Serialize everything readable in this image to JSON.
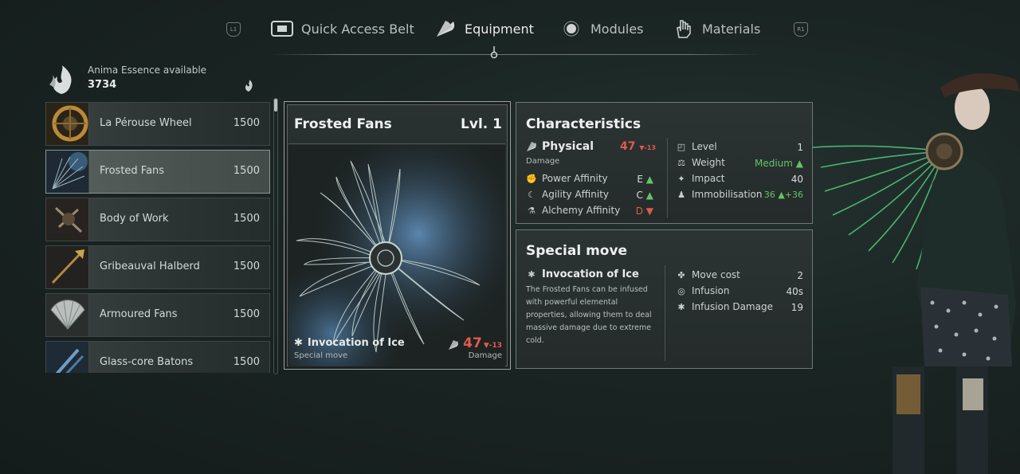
{
  "nav": {
    "left_bumper": "L1",
    "right_bumper": "R1",
    "tabs": [
      {
        "label": "Quick Access Belt",
        "icon": "belt-icon"
      },
      {
        "label": "Equipment",
        "icon": "fan-icon",
        "active": true
      },
      {
        "label": "Modules",
        "icon": "module-icon"
      },
      {
        "label": "Materials",
        "icon": "materials-hand-icon"
      }
    ]
  },
  "anima": {
    "label": "Anima Essence available",
    "value": "3734"
  },
  "weapons": [
    {
      "name": "La Pérouse Wheel",
      "cost": "1500"
    },
    {
      "name": "Frosted Fans",
      "cost": "1500",
      "selected": true
    },
    {
      "name": "Body of Work",
      "cost": "1500"
    },
    {
      "name": "Gribeauval Halberd",
      "cost": "1500"
    },
    {
      "name": "Armoured Fans",
      "cost": "1500"
    },
    {
      "name": "Glass-core Batons",
      "cost": "1500"
    }
  ],
  "card": {
    "title": "Frosted Fans",
    "level": "Lvl. 1",
    "special_move_name": "Invocation of Ice",
    "special_move_label": "Special move",
    "damage_value": "47",
    "damage_delta": "▼-13",
    "damage_label": "Damage"
  },
  "characteristics": {
    "title": "Characteristics",
    "damage_type": "Physical",
    "damage_type_value": "47",
    "damage_type_delta": "▼-13",
    "damage_sub": "Damage",
    "affinities": [
      {
        "label": "Power Affinity",
        "grade": "E",
        "trend": "▲",
        "trend_color": "#62c46a"
      },
      {
        "label": "Agility Affinity",
        "grade": "C",
        "trend": "▲",
        "trend_color": "#62c46a"
      },
      {
        "label": "Alchemy Affinity",
        "grade": "D",
        "trend": "▼",
        "trend_color": "#e05a4e"
      }
    ],
    "stats": [
      {
        "label": "Level",
        "value": "1"
      },
      {
        "label": "Weight",
        "value": "Medium ▲"
      },
      {
        "label": "Impact",
        "value": "40"
      },
      {
        "label": "Immobilisation",
        "value": "36 ▲+36"
      }
    ]
  },
  "special_move": {
    "title": "Special move",
    "name": "Invocation of Ice",
    "description": "The Frosted Fans can be infused with powerful elemental properties, allowing them to deal massive damage due to extreme cold.",
    "stats": [
      {
        "label": "Move cost",
        "value": "2"
      },
      {
        "label": "Infusion",
        "value": "40s"
      },
      {
        "label": "Infusion Damage",
        "value": "19"
      }
    ]
  }
}
